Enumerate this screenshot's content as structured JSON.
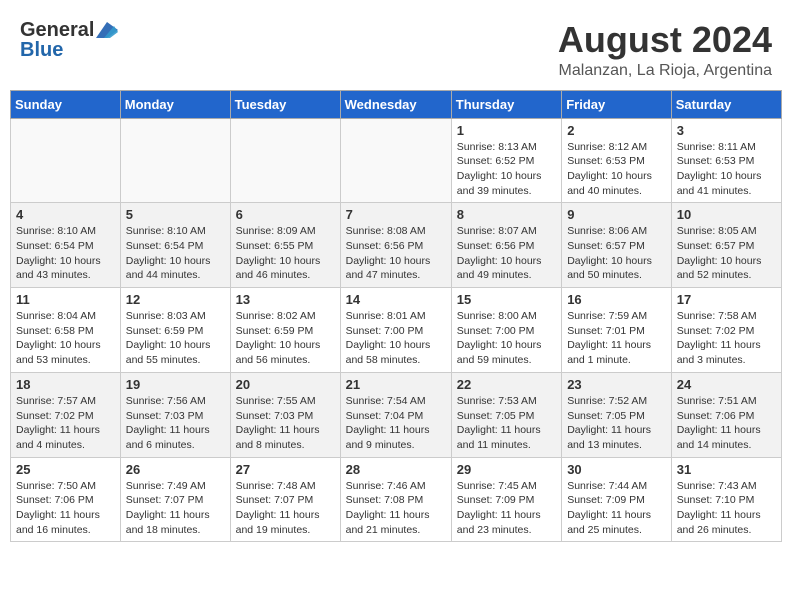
{
  "header": {
    "logo_general": "General",
    "logo_blue": "Blue",
    "main_title": "August 2024",
    "subtitle": "Malanzan, La Rioja, Argentina"
  },
  "calendar": {
    "days_of_week": [
      "Sunday",
      "Monday",
      "Tuesday",
      "Wednesday",
      "Thursday",
      "Friday",
      "Saturday"
    ],
    "weeks": [
      [
        {
          "day": "",
          "info": ""
        },
        {
          "day": "",
          "info": ""
        },
        {
          "day": "",
          "info": ""
        },
        {
          "day": "",
          "info": ""
        },
        {
          "day": "1",
          "info": "Sunrise: 8:13 AM\nSunset: 6:52 PM\nDaylight: 10 hours and 39 minutes."
        },
        {
          "day": "2",
          "info": "Sunrise: 8:12 AM\nSunset: 6:53 PM\nDaylight: 10 hours and 40 minutes."
        },
        {
          "day": "3",
          "info": "Sunrise: 8:11 AM\nSunset: 6:53 PM\nDaylight: 10 hours and 41 minutes."
        }
      ],
      [
        {
          "day": "4",
          "info": "Sunrise: 8:10 AM\nSunset: 6:54 PM\nDaylight: 10 hours and 43 minutes."
        },
        {
          "day": "5",
          "info": "Sunrise: 8:10 AM\nSunset: 6:54 PM\nDaylight: 10 hours and 44 minutes."
        },
        {
          "day": "6",
          "info": "Sunrise: 8:09 AM\nSunset: 6:55 PM\nDaylight: 10 hours and 46 minutes."
        },
        {
          "day": "7",
          "info": "Sunrise: 8:08 AM\nSunset: 6:56 PM\nDaylight: 10 hours and 47 minutes."
        },
        {
          "day": "8",
          "info": "Sunrise: 8:07 AM\nSunset: 6:56 PM\nDaylight: 10 hours and 49 minutes."
        },
        {
          "day": "9",
          "info": "Sunrise: 8:06 AM\nSunset: 6:57 PM\nDaylight: 10 hours and 50 minutes."
        },
        {
          "day": "10",
          "info": "Sunrise: 8:05 AM\nSunset: 6:57 PM\nDaylight: 10 hours and 52 minutes."
        }
      ],
      [
        {
          "day": "11",
          "info": "Sunrise: 8:04 AM\nSunset: 6:58 PM\nDaylight: 10 hours and 53 minutes."
        },
        {
          "day": "12",
          "info": "Sunrise: 8:03 AM\nSunset: 6:59 PM\nDaylight: 10 hours and 55 minutes."
        },
        {
          "day": "13",
          "info": "Sunrise: 8:02 AM\nSunset: 6:59 PM\nDaylight: 10 hours and 56 minutes."
        },
        {
          "day": "14",
          "info": "Sunrise: 8:01 AM\nSunset: 7:00 PM\nDaylight: 10 hours and 58 minutes."
        },
        {
          "day": "15",
          "info": "Sunrise: 8:00 AM\nSunset: 7:00 PM\nDaylight: 10 hours and 59 minutes."
        },
        {
          "day": "16",
          "info": "Sunrise: 7:59 AM\nSunset: 7:01 PM\nDaylight: 11 hours and 1 minute."
        },
        {
          "day": "17",
          "info": "Sunrise: 7:58 AM\nSunset: 7:02 PM\nDaylight: 11 hours and 3 minutes."
        }
      ],
      [
        {
          "day": "18",
          "info": "Sunrise: 7:57 AM\nSunset: 7:02 PM\nDaylight: 11 hours and 4 minutes."
        },
        {
          "day": "19",
          "info": "Sunrise: 7:56 AM\nSunset: 7:03 PM\nDaylight: 11 hours and 6 minutes."
        },
        {
          "day": "20",
          "info": "Sunrise: 7:55 AM\nSunset: 7:03 PM\nDaylight: 11 hours and 8 minutes."
        },
        {
          "day": "21",
          "info": "Sunrise: 7:54 AM\nSunset: 7:04 PM\nDaylight: 11 hours and 9 minutes."
        },
        {
          "day": "22",
          "info": "Sunrise: 7:53 AM\nSunset: 7:05 PM\nDaylight: 11 hours and 11 minutes."
        },
        {
          "day": "23",
          "info": "Sunrise: 7:52 AM\nSunset: 7:05 PM\nDaylight: 11 hours and 13 minutes."
        },
        {
          "day": "24",
          "info": "Sunrise: 7:51 AM\nSunset: 7:06 PM\nDaylight: 11 hours and 14 minutes."
        }
      ],
      [
        {
          "day": "25",
          "info": "Sunrise: 7:50 AM\nSunset: 7:06 PM\nDaylight: 11 hours and 16 minutes."
        },
        {
          "day": "26",
          "info": "Sunrise: 7:49 AM\nSunset: 7:07 PM\nDaylight: 11 hours and 18 minutes."
        },
        {
          "day": "27",
          "info": "Sunrise: 7:48 AM\nSunset: 7:07 PM\nDaylight: 11 hours and 19 minutes."
        },
        {
          "day": "28",
          "info": "Sunrise: 7:46 AM\nSunset: 7:08 PM\nDaylight: 11 hours and 21 minutes."
        },
        {
          "day": "29",
          "info": "Sunrise: 7:45 AM\nSunset: 7:09 PM\nDaylight: 11 hours and 23 minutes."
        },
        {
          "day": "30",
          "info": "Sunrise: 7:44 AM\nSunset: 7:09 PM\nDaylight: 11 hours and 25 minutes."
        },
        {
          "day": "31",
          "info": "Sunrise: 7:43 AM\nSunset: 7:10 PM\nDaylight: 11 hours and 26 minutes."
        }
      ]
    ]
  }
}
